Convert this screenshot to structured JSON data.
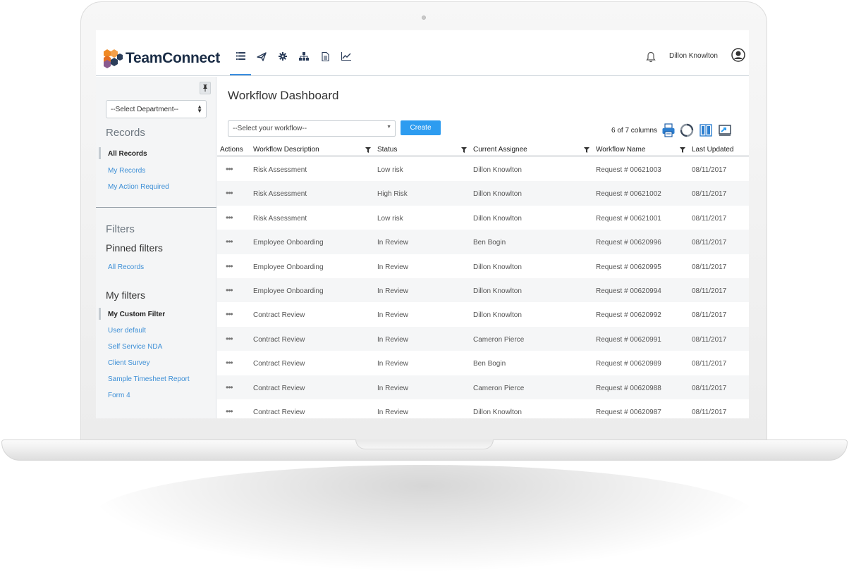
{
  "app": {
    "brand": "TeamConnect",
    "user_name": "Dillon Knowlton",
    "nav_icons": [
      "list-icon",
      "send-icon",
      "gear-icon",
      "org-chart-icon",
      "document-icon",
      "trend-icon"
    ]
  },
  "sidebar": {
    "department_select": "--Select Department--",
    "records_heading": "Records",
    "records_items": [
      "All Records",
      "My Records",
      "My Action Required"
    ],
    "filters_heading": "Filters",
    "pinned_heading": "Pinned filters",
    "pinned_items": [
      "All Records"
    ],
    "my_filters_heading": "My filters",
    "my_filter_items": [
      "My Custom Filter",
      "User default",
      "Self Service NDA",
      "Client Survey",
      "Sample Timesheet Report",
      "Form 4"
    ]
  },
  "main": {
    "title": "Workflow Dashboard",
    "workflow_select": "--Select your workflow--",
    "create_label": "Create",
    "column_count": "6 of 7 columns",
    "tools": [
      "print-icon",
      "refresh-icon",
      "columns-icon",
      "export-icon"
    ]
  },
  "table": {
    "headers": [
      "Actions",
      "Workflow Description",
      "Status",
      "Current Assignee",
      "Workflow Name",
      "Last Updated"
    ],
    "rows": [
      [
        "Risk Assessment",
        "Low risk",
        "Dillon Knowlton",
        "Request # 00621003",
        "08/11/2017"
      ],
      [
        "Risk Assessment",
        "High Risk",
        "Dillon Knowlton",
        "Request # 00621002",
        "08/11/2017"
      ],
      [
        "Risk Assessment",
        "Low risk",
        "Dillon Knowlton",
        "Request # 00621001",
        "08/11/2017"
      ],
      [
        "Employee Onboarding",
        "In Review",
        "Ben Bogin",
        "Request # 00620996",
        "08/11/2017"
      ],
      [
        "Employee Onboarding",
        "In Review",
        "Dillon Knowlton",
        "Request # 00620995",
        "08/11/2017"
      ],
      [
        "Employee Onboarding",
        "In Review",
        "Dillon Knowlton",
        "Request # 00620994",
        "08/11/2017"
      ],
      [
        "Contract Review",
        "In Review",
        "Dillon Knowlton",
        "Request # 00620992",
        "08/11/2017"
      ],
      [
        "Contract Review",
        "In Review",
        "Cameron Pierce",
        "Request # 00620991",
        "08/11/2017"
      ],
      [
        "Contract Review",
        "In Review",
        "Ben Bogin",
        "Request # 00620989",
        "08/11/2017"
      ],
      [
        "Contract Review",
        "In Review",
        "Cameron Pierce",
        "Request # 00620988",
        "08/11/2017"
      ],
      [
        "Contract Review",
        "In Review",
        "Dillon Knowlton",
        "Request # 00620987",
        "08/11/2017"
      ]
    ]
  },
  "colors": {
    "accent": "#2d9cf0",
    "link": "#3d8fd6",
    "brand_text": "#1b2d46",
    "logo_orange": "#f08a24",
    "logo_navy": "#2b3d5a"
  }
}
